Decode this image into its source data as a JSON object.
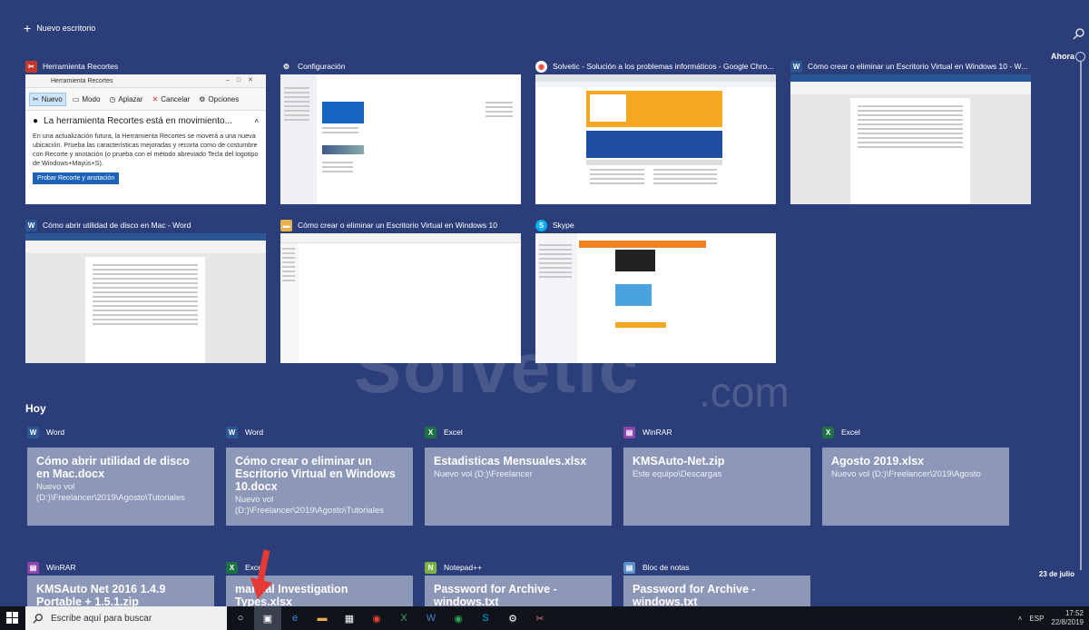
{
  "top": {
    "new_desktop": "Nuevo escritorio",
    "ahora": "Ahora",
    "date_marker": "23 de julio"
  },
  "windows": [
    {
      "title": "Herramienta Recortes",
      "icon": "scissors-icon",
      "color": "#c0392b"
    },
    {
      "title": "Configuración",
      "icon": "gear-icon",
      "color": "#2b3e79"
    },
    {
      "title": "Solvetic - Solución a los problemas informáticos - Google Chro...",
      "icon": "chrome-icon",
      "color": "#ea4335"
    },
    {
      "title": "Cómo crear o eliminar un Escritorio Virtual en Windows 10 - W...",
      "icon": "word-icon",
      "color": "#2b5797"
    },
    {
      "title": "Cómo abrir utilidad de disco en Mac - Word",
      "icon": "word-icon",
      "color": "#2b5797"
    },
    {
      "title": "Cómo crear o eliminar un Escritorio Virtual en Windows 10",
      "icon": "folder-icon",
      "color": "#e8b04a"
    },
    {
      "title": "Skype",
      "icon": "skype-icon",
      "color": "#00aff0"
    }
  ],
  "snipping": {
    "window_title": "Herramienta Recortes",
    "toolbar": {
      "nuevo": "Nuevo",
      "modo": "Modo",
      "aplazar": "Aplazar",
      "cancelar": "Cancelar",
      "opciones": "Opciones"
    },
    "heading": "La herramienta Recortes está en movimiento...",
    "body": "En una actualización futura, la Herramienta Recortes se moverá a una nueva ubicación. Prueba las características mejoradas y recorta como de costumbre con Recorte y anotación (o prueba con el método abreviado Tecla del logotipo de Windows+Mayús+S).",
    "button": "Probar Recorte y anotación"
  },
  "hoy_label": "Hoy",
  "cards": [
    {
      "app": "Word",
      "icon": "word-icon",
      "color": "#2b5797",
      "title": "Cómo abrir utilidad de disco en Mac.docx",
      "path": "Nuevo vol (D:)\\Freelancer\\2019\\Agosto\\Tutoriales"
    },
    {
      "app": "Word",
      "icon": "word-icon",
      "color": "#2b5797",
      "title": "Cómo crear o eliminar un Escritorio Virtual en Windows 10.docx",
      "path": "Nuevo vol (D:)\\Freelancer\\2019\\Agosto\\Tutoriales"
    },
    {
      "app": "Excel",
      "icon": "excel-icon",
      "color": "#1e7145",
      "title": "Estadisticas Mensuales.xlsx",
      "path": "Nuevo vol (D:)\\Freelancer"
    },
    {
      "app": "WinRAR",
      "icon": "winrar-icon",
      "color": "#8e44ad",
      "title": "KMSAuto-Net.zip",
      "path": "Este equipo\\Descargas"
    },
    {
      "app": "Excel",
      "icon": "excel-icon",
      "color": "#1e7145",
      "title": "Agosto  2019.xlsx",
      "path": "Nuevo vol (D:)\\Freelancer\\2019\\Agosto"
    },
    {
      "app": "WinRAR",
      "icon": "winrar-icon",
      "color": "#8e44ad",
      "title": "KMSAuto Net 2016 1.4.9 Portable + 1.5.1.zip",
      "path": ""
    },
    {
      "app": "Excel",
      "icon": "excel-icon",
      "color": "#1e7145",
      "title": "manual Investigation Types.xlsx",
      "path": ""
    },
    {
      "app": "Notepad++",
      "icon": "notepad-plus-icon",
      "color": "#7cb342",
      "title": "Password for Archive - windows.txt",
      "path": ""
    },
    {
      "app": "Bloc de notas",
      "icon": "notepad-icon",
      "color": "#5d8fc9",
      "title": "Password for Archive - windows.txt",
      "path": ""
    }
  ],
  "watermark": {
    "text": "Solvetic",
    "domain": ".com"
  },
  "taskbar": {
    "search_placeholder": "Escribe aquí para buscar",
    "language": "ESP",
    "time": "17:52",
    "date": "22/8/2019"
  }
}
